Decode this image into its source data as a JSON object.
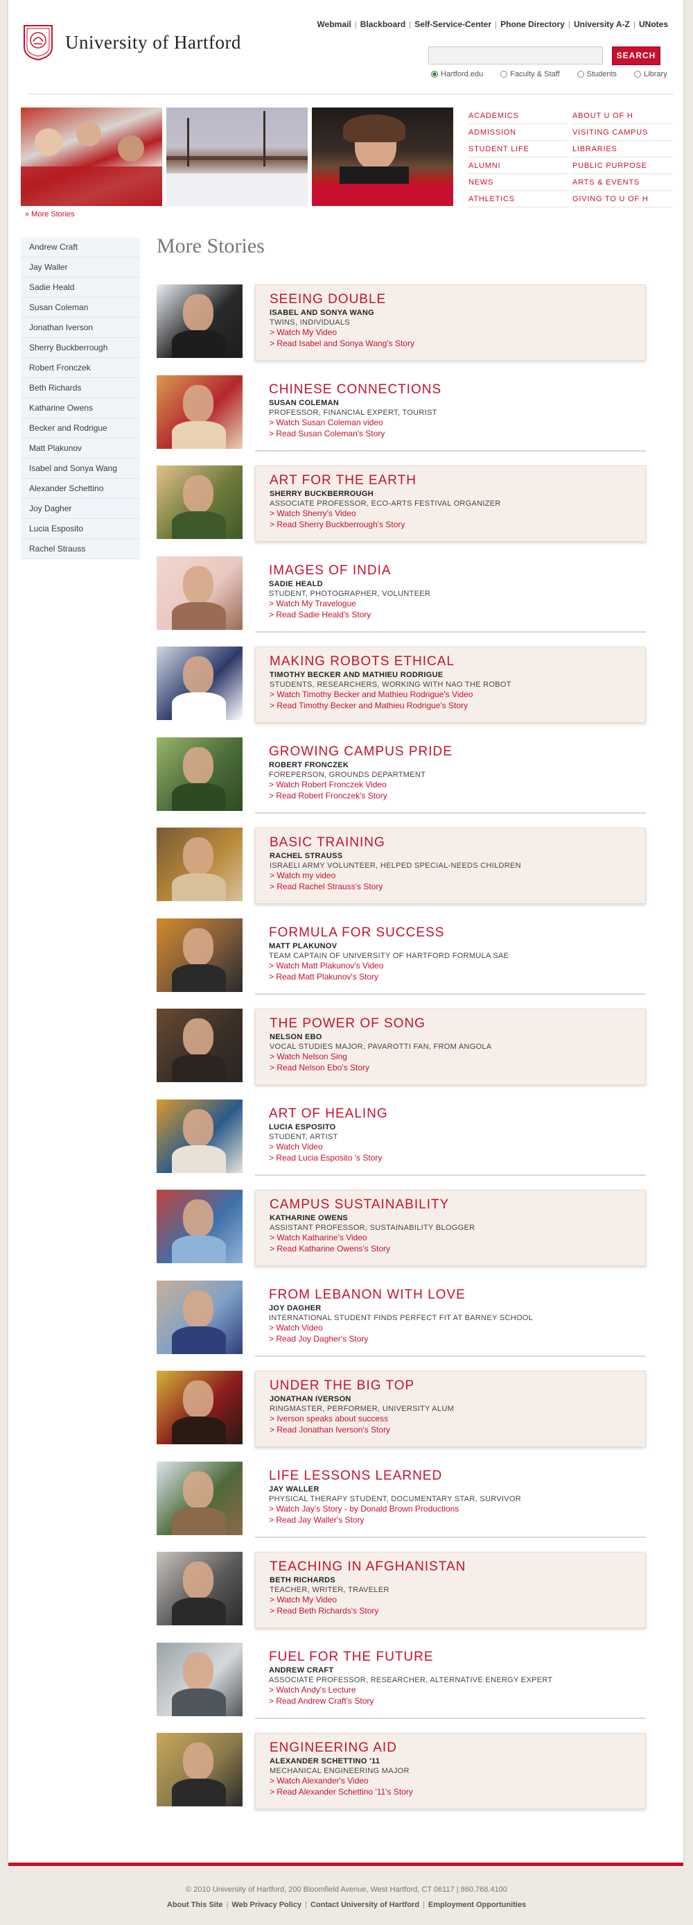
{
  "site": {
    "logo_text": "University of Hartford"
  },
  "utility_nav": [
    "Webmail",
    "Blackboard",
    "Self-Service-Center",
    "Phone Directory",
    "University A-Z",
    "UNotes"
  ],
  "search": {
    "button_label": "SEARCH",
    "scopes": [
      {
        "label": "Hartford.edu",
        "selected": true
      },
      {
        "label": "Faculty & Staff",
        "selected": false
      },
      {
        "label": "Students",
        "selected": false
      },
      {
        "label": "Library",
        "selected": false
      }
    ]
  },
  "more_stories_link": "» More Stories",
  "main_nav": {
    "col1": [
      "ACADEMICS",
      "ADMISSION",
      "STUDENT LIFE",
      "ALUMNI",
      "NEWS",
      "ATHLETICS"
    ],
    "col2": [
      "ABOUT U OF H",
      "VISITING CAMPUS",
      "LIBRARIES",
      "PUBLIC PURPOSE",
      "ARTS & EVENTS",
      "GIVING TO U OF H"
    ]
  },
  "sidebar": [
    "Andrew Craft",
    "Jay Waller",
    "Sadie Heald",
    "Susan Coleman",
    "Jonathan Iverson",
    "Sherry Buckberrough",
    "Robert Fronczek",
    "Beth Richards",
    "Katharine Owens",
    "Becker and Rodrigue",
    "Matt Plakunov",
    "Isabel and Sonya Wang",
    "Alexander Schettino",
    "Joy Dagher",
    "Lucia Esposito",
    "Rachel Strauss"
  ],
  "section_title": "More Stories",
  "stories": [
    {
      "title": "SEEING DOUBLE",
      "name": "ISABEL AND SONYA WANG",
      "subtitle": "TWINS, INDIVIDUALS",
      "links": [
        "> Watch My Video",
        "> Read Isabel and Sonya Wang's Story"
      ]
    },
    {
      "title": "CHINESE CONNECTIONS",
      "name": "SUSAN COLEMAN",
      "subtitle": "PROFESSOR, FINANCIAL EXPERT, TOURIST",
      "links": [
        "> Watch Susan Coleman video",
        "> Read Susan Coleman's Story"
      ]
    },
    {
      "title": "ART FOR THE EARTH",
      "name": "SHERRY BUCKBERROUGH",
      "subtitle": "ASSOCIATE PROFESSOR, ECO-ARTS FESTIVAL ORGANIZER",
      "links": [
        "> Watch Sherry's Video",
        "> Read Sherry Buckberrough's Story"
      ]
    },
    {
      "title": "IMAGES OF INDIA",
      "name": "SADIE HEALD",
      "subtitle": "STUDENT, PHOTOGRAPHER, VOLUNTEER",
      "links": [
        "> Watch My Travelogue",
        "> Read Sadie Heald's Story"
      ]
    },
    {
      "title": "MAKING ROBOTS ETHICAL",
      "name": "TIMOTHY BECKER AND MATHIEU RODRIGUE",
      "subtitle": "STUDENTS, RESEARCHERS, WORKING WITH NAO THE ROBOT",
      "links": [
        "> Watch Timothy Becker and Mathieu Rodrigue's Video",
        "> Read Timothy Becker and Mathieu Rodrigue's Story"
      ]
    },
    {
      "title": "GROWING CAMPUS PRIDE",
      "name": "ROBERT FRONCZEK",
      "subtitle": "FOREPERSON, GROUNDS DEPARTMENT",
      "links": [
        "> Watch Robert Fronczek Video",
        "> Read Robert Fronczek's Story"
      ]
    },
    {
      "title": "BASIC TRAINING",
      "name": "RACHEL STRAUSS",
      "subtitle": "ISRAELI ARMY VOLUNTEER, HELPED SPECIAL-NEEDS CHILDREN",
      "links": [
        "> Watch my video",
        "> Read Rachel Strauss's Story"
      ]
    },
    {
      "title": "FORMULA FOR SUCCESS",
      "name": "MATT PLAKUNOV",
      "subtitle": "TEAM CAPTAIN OF UNIVERSITY OF HARTFORD FORMULA SAE",
      "links": [
        "> Watch Matt Plakunov's Video",
        "> Read Matt Plakunov's Story"
      ]
    },
    {
      "title": "THE POWER OF SONG",
      "name": "NELSON EBO",
      "subtitle": "VOCAL STUDIES MAJOR, PAVAROTTI FAN, FROM ANGOLA",
      "links": [
        "> Watch Nelson Sing",
        "> Read Nelson Ebo's Story"
      ]
    },
    {
      "title": "ART OF HEALING",
      "name": "LUCIA ESPOSITO",
      "subtitle": "STUDENT, ARTIST",
      "links": [
        "> Watch Video",
        "> Read Lucia Esposito 's Story"
      ]
    },
    {
      "title": "CAMPUS SUSTAINABILITY",
      "name": "KATHARINE OWENS",
      "subtitle": "ASSISTANT PROFESSOR, SUSTAINABILITY BLOGGER",
      "links": [
        "> Watch Katharine's Video",
        "> Read Katharine Owens's Story"
      ]
    },
    {
      "title": "FROM LEBANON WITH LOVE",
      "name": "JOY DAGHER",
      "subtitle": "INTERNATIONAL STUDENT FINDS PERFECT FIT AT BARNEY SCHOOL",
      "links": [
        "> Watch Video",
        "> Read Joy Dagher's Story"
      ]
    },
    {
      "title": "UNDER THE BIG TOP",
      "name": "JONATHAN IVERSON",
      "subtitle": "RINGMASTER, PERFORMER, UNIVERSITY ALUM",
      "links": [
        "> Iverson speaks about success",
        "> Read Jonathan Iverson's Story"
      ]
    },
    {
      "title": "LIFE LESSONS LEARNED",
      "name": "JAY WALLER",
      "subtitle": "PHYSICAL THERAPY STUDENT, DOCUMENTARY STAR, SURVIVOR",
      "links": [
        "> Watch Jay's Story - by Donald Brown Productions",
        "> Read Jay Waller's Story"
      ]
    },
    {
      "title": "TEACHING IN AFGHANISTAN",
      "name": "BETH RICHARDS",
      "subtitle": "TEACHER, WRITER, TRAVELER",
      "links": [
        "> Watch My Video",
        "> Read Beth Richards's Story"
      ]
    },
    {
      "title": "FUEL FOR THE FUTURE",
      "name": "ANDREW CRAFT",
      "subtitle": "ASSOCIATE PROFESSOR, RESEARCHER, ALTERNATIVE ENERGY EXPERT",
      "links": [
        "> Watch Andy's Lecture",
        "> Read Andrew Craft's Story"
      ]
    },
    {
      "title": "ENGINEERING AID",
      "name": "ALEXANDER SCHETTINO '11",
      "subtitle": "MECHANICAL ENGINEERING MAJOR",
      "links": [
        "> Watch Alexander's Video",
        "> Read Alexander Schettino '11's Story"
      ]
    }
  ],
  "footer": {
    "copyright": "© 2010 University of Hartford, 200 Bloomfield Avenue, West Hartford, CT 06117 | 860.768.4100",
    "links": [
      "About This Site",
      "Web Privacy Policy",
      "Contact University of Hartford",
      "Employment Opportunities"
    ]
  },
  "colors": {
    "accent": "#c8102e",
    "card_bg": "#f6efe9",
    "sidebar_bg": "#f1f5fa",
    "page_bg": "#eeeae2"
  }
}
